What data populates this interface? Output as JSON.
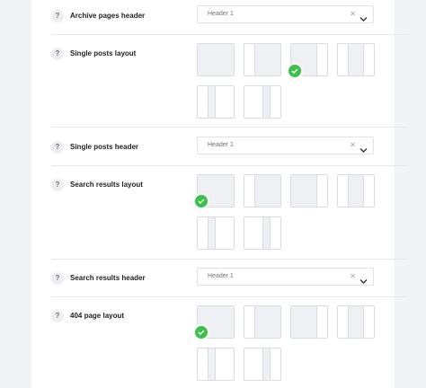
{
  "help_glyph": "?",
  "rows": {
    "archive_header": {
      "label": "Archive pages header",
      "value": "Header 1"
    },
    "single_layout": {
      "label": "Single posts layout",
      "selected_option": 3
    },
    "single_header": {
      "label": "Single posts header",
      "value": "Header 1"
    },
    "search_layout": {
      "label": "Search results layout",
      "selected_option": 1
    },
    "search_header": {
      "label": "Search results header",
      "value": "Header 1"
    },
    "error_layout": {
      "label": "404 page layout",
      "selected_option": 1
    }
  },
  "layout_options": [
    "full-width",
    "right-sidebar",
    "left-sidebar",
    "both-sidebars",
    "left-sidebar-narrow",
    "right-sidebar-narrow"
  ],
  "clear_glyph": "✕",
  "icons": {
    "help": "question-icon",
    "clear": "clear-icon",
    "chevron": "chevron-down-icon",
    "check": "check-icon"
  },
  "colors": {
    "accent": "#3ac24a",
    "thumb_fill": "#eef0f3",
    "border": "#dfe2e6"
  }
}
